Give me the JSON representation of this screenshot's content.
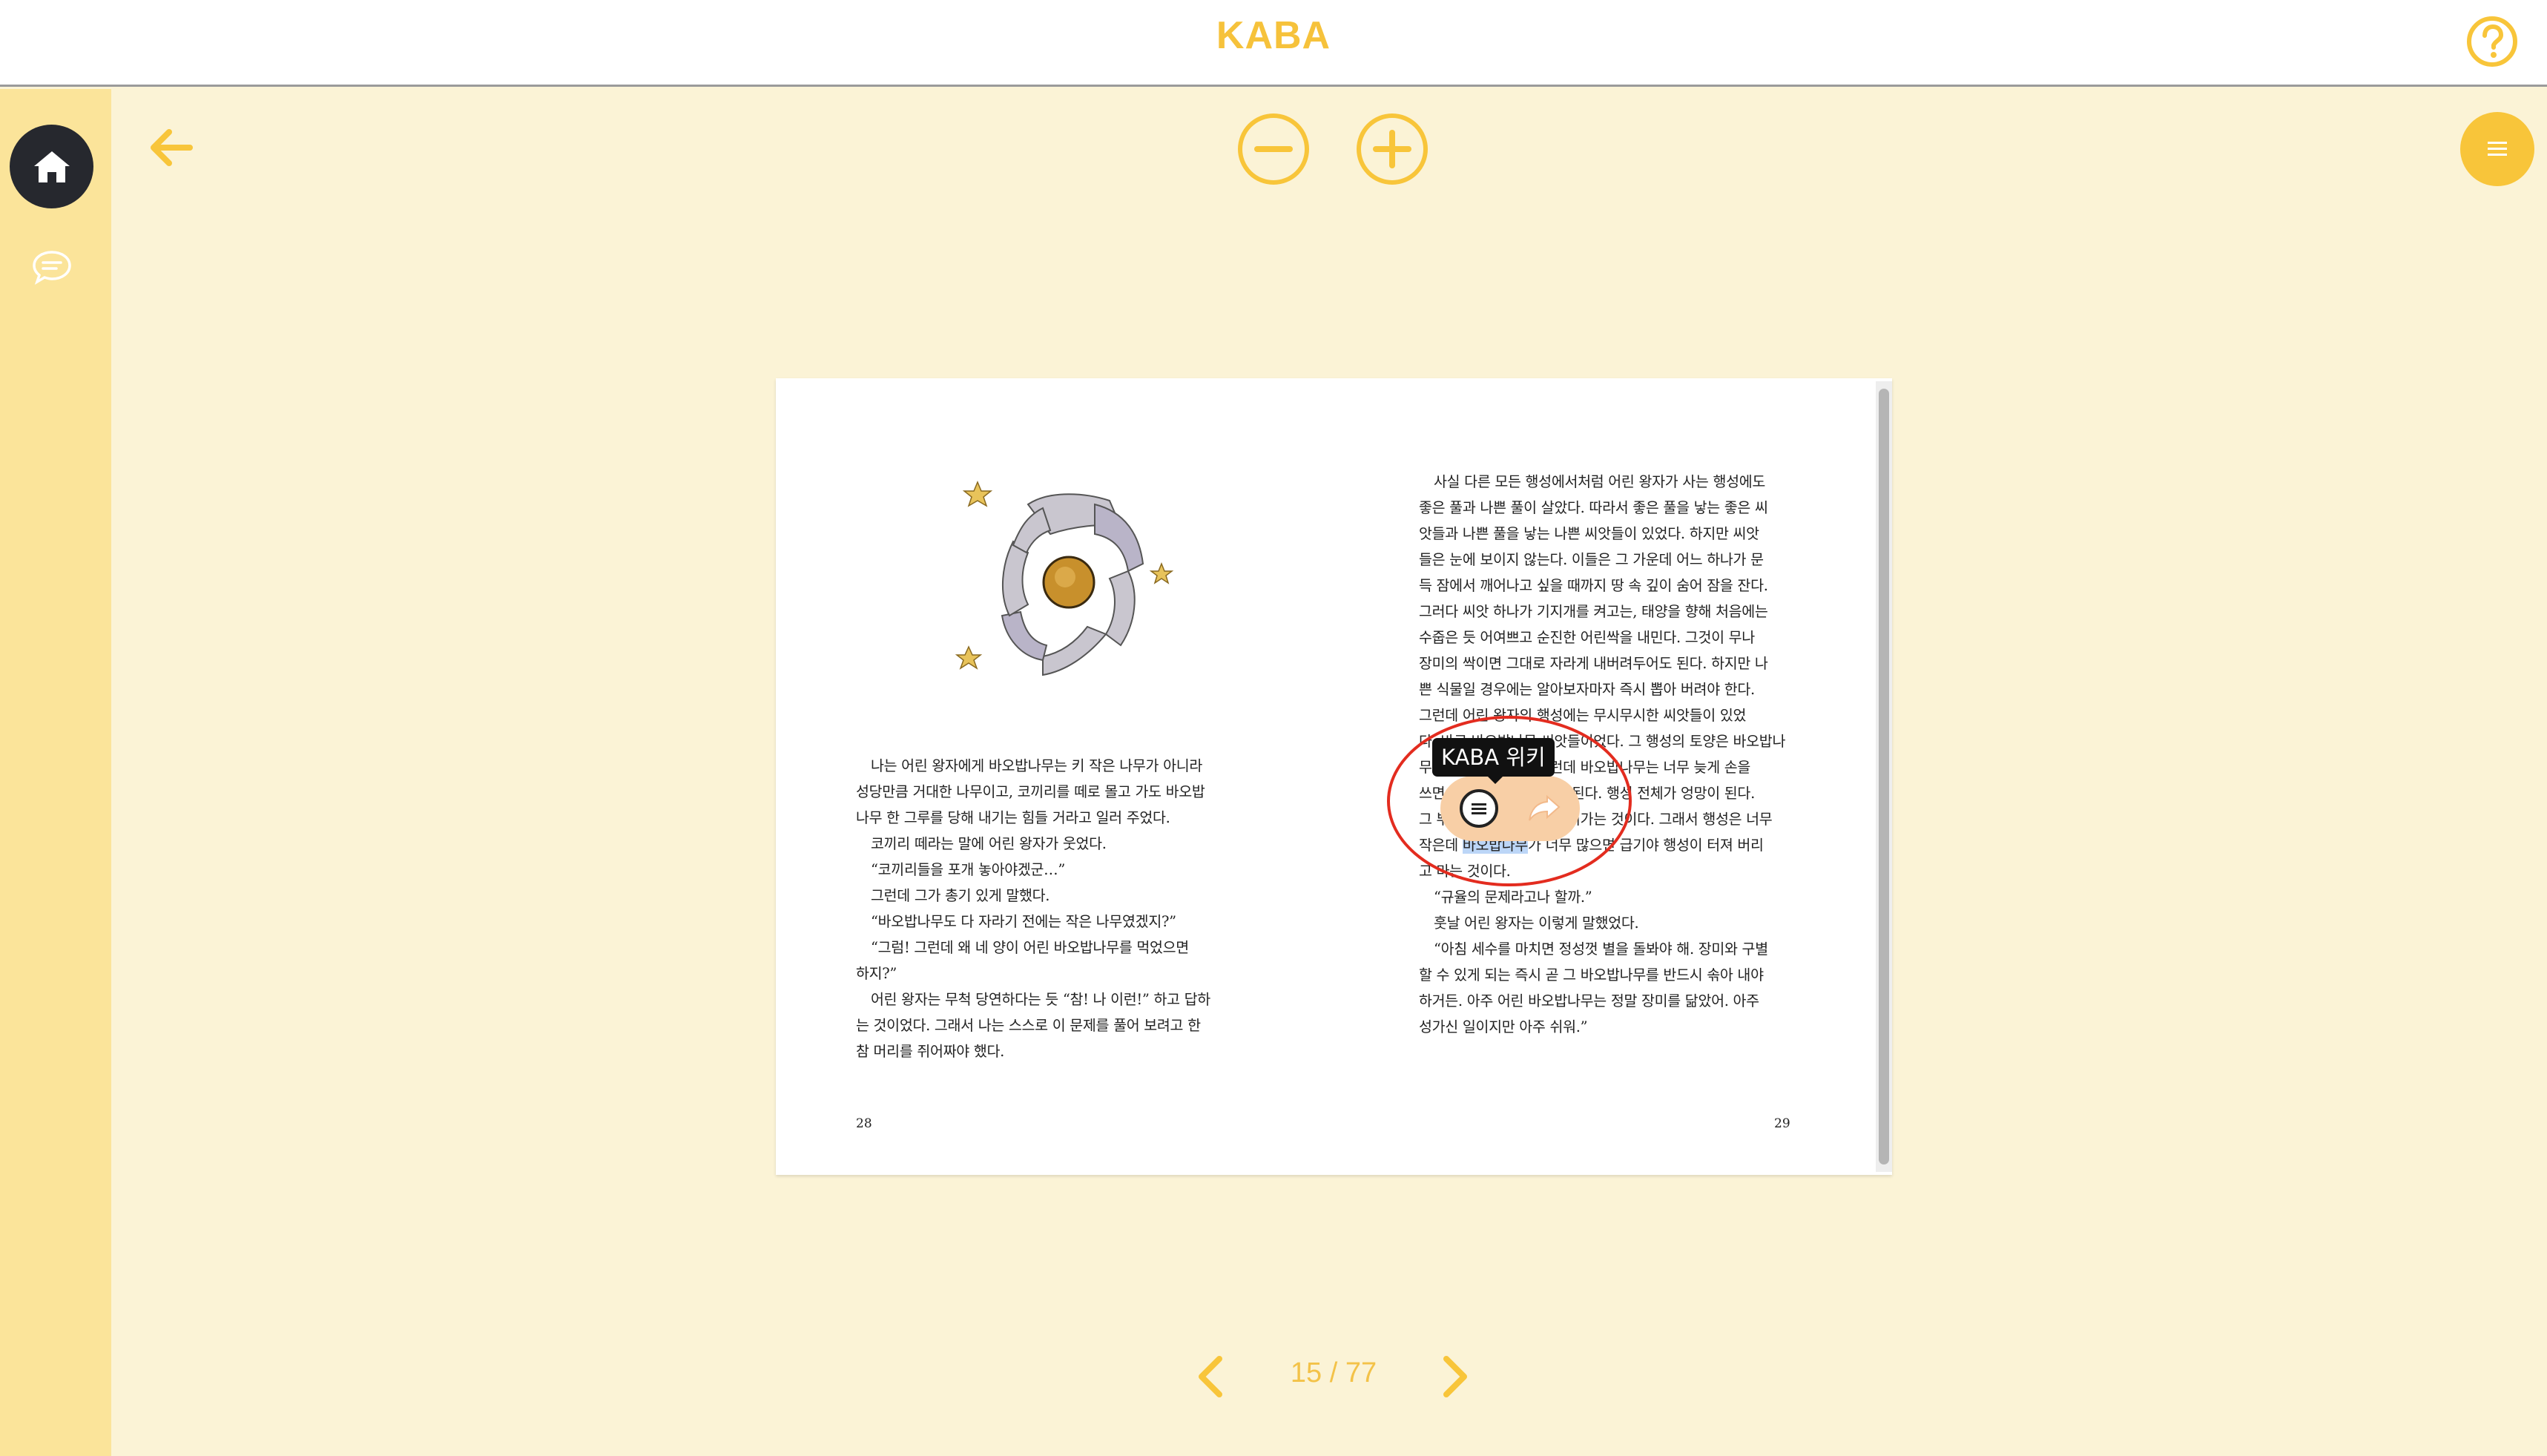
{
  "app": {
    "title": "KABA"
  },
  "colors": {
    "accent": "#f8c53a",
    "sidebar_bg": "#fbe49a",
    "page_bg": "#fbf3d6",
    "highlight": "#bcd6f7",
    "annotation_circle": "#e32c1f"
  },
  "icons": {
    "help": "question-circle-icon",
    "home": "home-icon",
    "chat": "chat-bubble-icon",
    "back": "arrow-left-icon",
    "zoom_out": "minus-circle-icon",
    "zoom_in": "plus-circle-icon",
    "menu": "hamburger-menu-icon",
    "wiki": "wiki-menu-icon",
    "share": "share-icon",
    "prev": "chevron-left-icon",
    "next": "chevron-right-icon"
  },
  "book": {
    "left_page": {
      "lines": [
        "나는 어린 왕자에게 바오밥나무는 키 작은 나무가 아니라",
        "성당만큼 거대한 나무이고, 코끼리를 떼로 몰고 가도 바오밥",
        "나무 한 그루를 당해 내기는 힘들 거라고 일러 주었다.",
        "코끼리 떼라는 말에 어린 왕자가 웃었다.",
        "“코끼리들을 포개 놓아야겠군…”",
        "그런데 그가 총기 있게 말했다.",
        "“바오밥나무도 다 자라기 전에는 작은 나무였겠지?”",
        "“그럼! 그런데 왜 네 양이 어린 바오밥나무를 먹었으면",
        "하지?”",
        "어린 왕자는 무척 당연하다는 듯 “참! 나 이런!” 하고 답하",
        "는 것이었다. 그래서 나는 스스로 이 문제를 풀어 보려고 한",
        "참 머리를 쥐어짜야 했다."
      ],
      "page_number": "28"
    },
    "right_page": {
      "lines": [
        "사실 다른 모든 행성에서처럼 어린 왕자가 사는 행성에도",
        "좋은 풀과 나쁜 풀이 살았다. 따라서 좋은 풀을 낳는 좋은 씨",
        "앗들과 나쁜 풀을 낳는 나쁜 씨앗들이 있었다. 하지만 씨앗",
        "들은 눈에 보이지 않는다. 이들은 그 가운데 어느 하나가 문",
        "득 잠에서 깨어나고 싶을 때까지 땅 속 깊이 숨어 잠을 잔다.",
        "그러다 씨앗 하나가 기지개를 켜고는, 태양을 향해 처음에는",
        "수줍은 듯 어여쁘고 순진한 어린싹을 내민다. 그것이 무나",
        "장미의 싹이면 그대로 자라게 내버려두어도 된다. 하지만 나",
        "쁜 식물일 경우에는 알아보자마자 즉시 뽑아 버려야 한다.",
        "그런데 어린 왕자의 행성에는 무시무시한 씨앗들이 있었",
        "다. 바로 바오밥나무 씨앗들이었다. 그 행성의 토양은 바오밥나",
        "무 씨앗투성이였다. 그런데 바오밥나무는 너무 늦게 손을",
        "쓰면 영영 없앨 수가 없게 된다. 행성 전체가 엉망이 된다.",
        "그 뿌리가 행성을 뚫고 들어가는 것이다. 그래서 행성은 너무",
        "작은데",
        "바오밥나무",
        "가 너무 많으면 급기야 행성이 터져 버리",
        "고 마는 것이다.",
        "“규율의 문제라고나 할까.”",
        "훗날 어린 왕자는 이렇게 말했었다.",
        "“아침 세수를 마치면 정성껏 별을 돌봐야 해. 장미와 구별",
        "할 수 있게 되는 즉시 곧 그 바오밥나무를 반드시 솎아 내야",
        "하거든. 아주 어린 바오밥나무는 정말 장미를 닮았어. 아주",
        "성가신 일이지만 아주 쉬워.”"
      ],
      "page_number": "29"
    }
  },
  "popup": {
    "tooltip": "KABA 위키"
  },
  "pagination": {
    "current": "15",
    "separator": "/",
    "total": "77"
  }
}
